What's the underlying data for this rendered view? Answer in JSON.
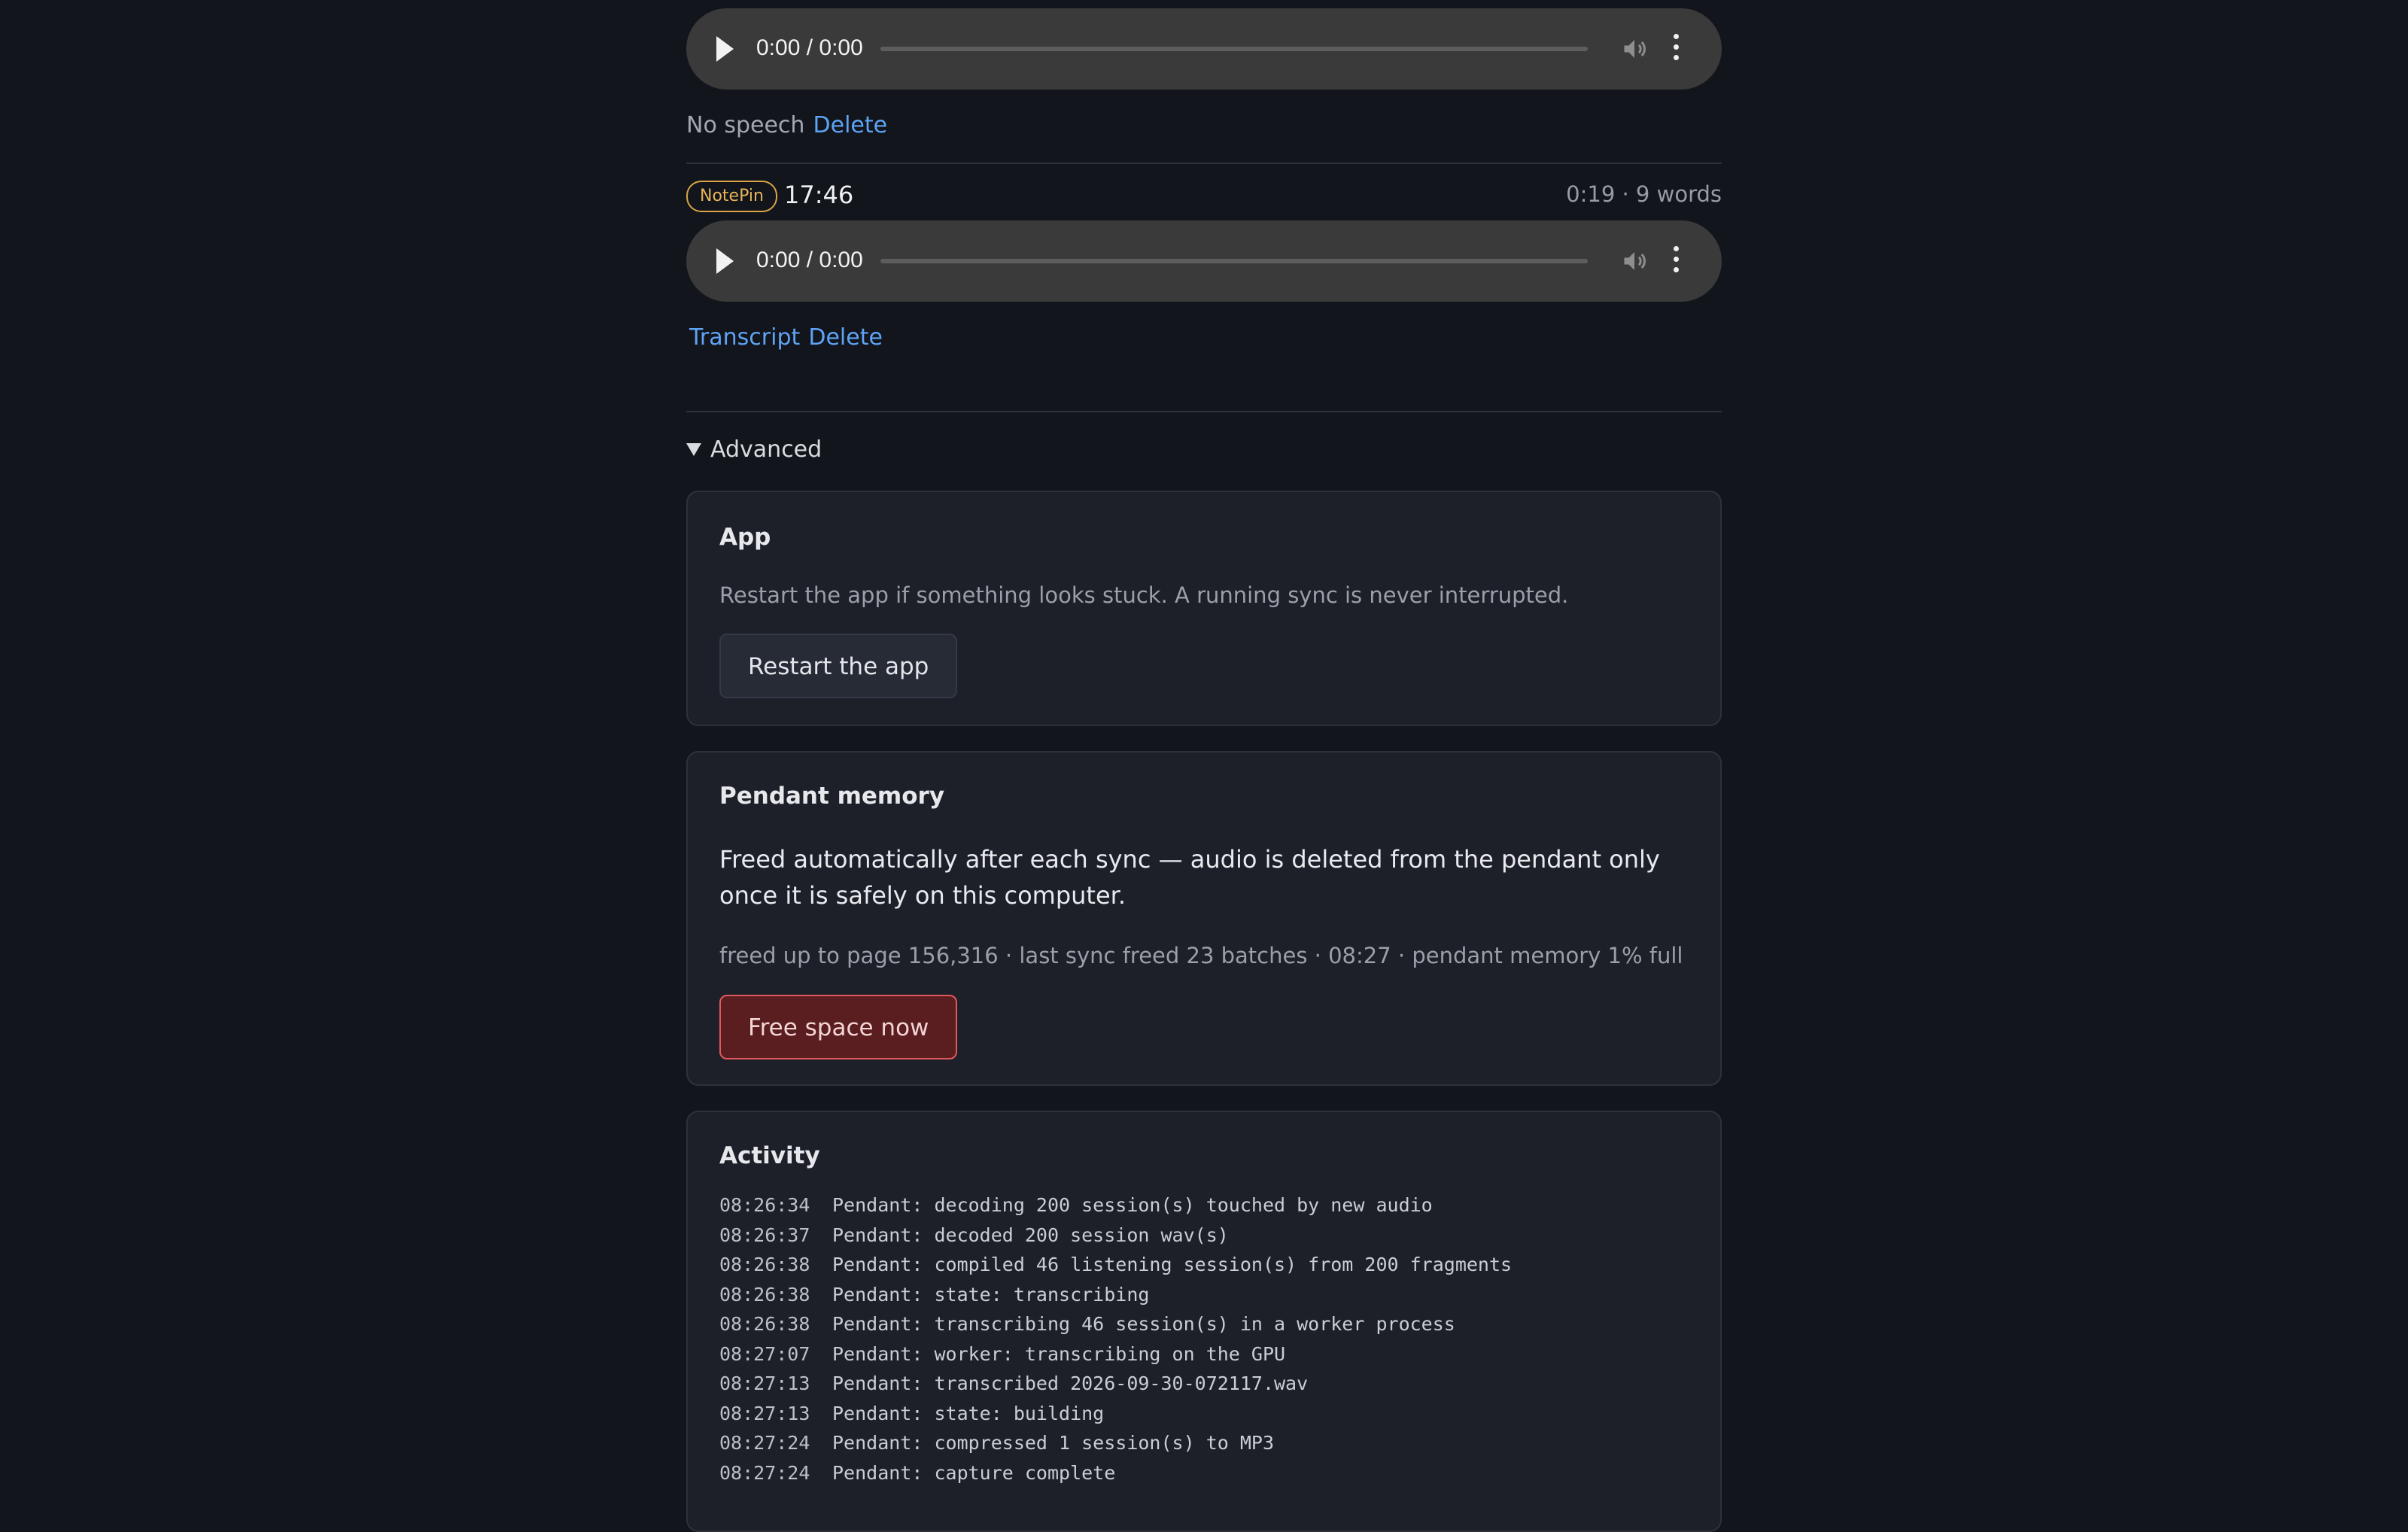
{
  "recordings": [
    {
      "player": {
        "time": "0:00 / 0:00"
      },
      "status": "No speech",
      "actions": {
        "delete": "Delete"
      }
    },
    {
      "source_badge": "NotePin",
      "time_of_day": "17:46",
      "meta": "0:19 · 9 words",
      "player": {
        "time": "0:00 / 0:00"
      },
      "actions": {
        "transcript": "Transcript",
        "delete": "Delete"
      }
    }
  ],
  "advanced": {
    "label": "Advanced",
    "app_card": {
      "title": "App",
      "description": "Restart the app if something looks stuck. A running sync is never interrupted.",
      "button": "Restart the app"
    },
    "memory_card": {
      "title": "Pendant memory",
      "body": "Freed automatically after each sync — audio is deleted from the pendant only once it is safely on this computer.",
      "stats": "freed up to page 156,316 · last sync freed 23 batches · 08:27 · pendant memory 1% full",
      "button": "Free space now"
    },
    "activity_card": {
      "title": "Activity",
      "log": [
        {
          "time": "08:26:34",
          "message": "Pendant: decoding 200 session(s) touched by new audio"
        },
        {
          "time": "08:26:37",
          "message": "Pendant: decoded 200 session wav(s)"
        },
        {
          "time": "08:26:38",
          "message": "Pendant: compiled 46 listening session(s) from 200 fragments"
        },
        {
          "time": "08:26:38",
          "message": "Pendant: state: transcribing"
        },
        {
          "time": "08:26:38",
          "message": "Pendant: transcribing 46 session(s) in a worker process"
        },
        {
          "time": "08:27:07",
          "message": "Pendant: worker: transcribing on the GPU"
        },
        {
          "time": "08:27:13",
          "message": "Pendant: transcribed 2026-09-30-072117.wav"
        },
        {
          "time": "08:27:13",
          "message": "Pendant: state: building"
        },
        {
          "time": "08:27:24",
          "message": "Pendant: compressed 1 session(s) to MP3"
        },
        {
          "time": "08:27:24",
          "message": "Pendant: capture complete"
        }
      ]
    }
  },
  "colors": {
    "background": "#12151b",
    "card": "#1d2029",
    "link": "#5ea3f5",
    "badge": "#d8a447",
    "danger_fill": "#5a1d20",
    "danger_border": "#e0595d"
  },
  "icons": [
    "play-icon",
    "volume-icon",
    "more-options-icon",
    "disclosure-triangle-icon"
  ]
}
